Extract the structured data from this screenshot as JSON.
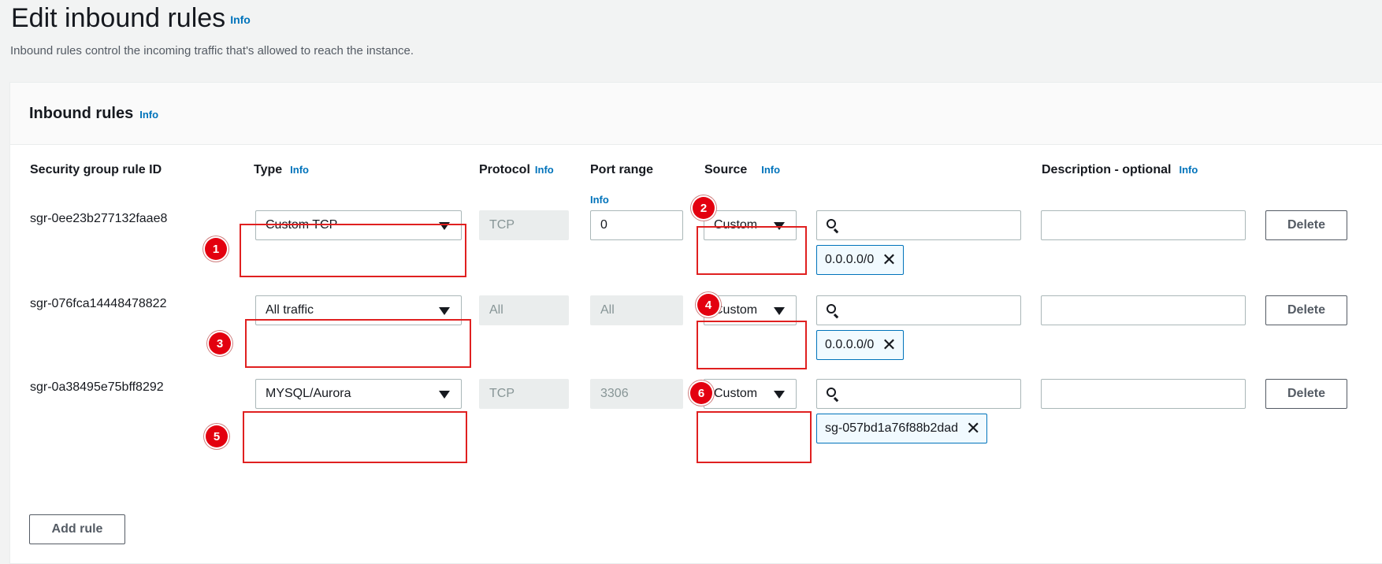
{
  "page": {
    "title": "Edit inbound rules",
    "info_label": "Info",
    "description": "Inbound rules control the incoming traffic that's allowed to reach the instance."
  },
  "panel": {
    "title": "Inbound rules",
    "info_label": "Info"
  },
  "columns": {
    "rule_id": "Security group rule ID",
    "type": "Type",
    "protocol": "Protocol",
    "port_range": "Port range",
    "source": "Source",
    "description": "Description - optional",
    "info_label": "Info"
  },
  "rules": [
    {
      "id": "sgr-0ee23b277132faae8",
      "type": "Custom TCP",
      "protocol": "TCP",
      "port_range": "0",
      "source_mode": "Custom",
      "source_search": "",
      "source_token": "0.0.0.0/0",
      "description": "",
      "delete_label": "Delete"
    },
    {
      "id": "sgr-076fca14448478822",
      "type": "All traffic",
      "protocol": "All",
      "port_range": "All",
      "source_mode": "Custom",
      "source_search": "",
      "source_token": "0.0.0.0/0",
      "description": "",
      "delete_label": "Delete"
    },
    {
      "id": "sgr-0a38495e75bff8292",
      "type": "MYSQL/Aurora",
      "protocol": "TCP",
      "port_range": "3306",
      "source_mode": "Custom",
      "source_search": "",
      "source_token": "sg-057bd1a76f88b2dad",
      "description": "",
      "delete_label": "Delete"
    }
  ],
  "add_rule_label": "Add rule",
  "annotations": [
    "1",
    "2",
    "3",
    "4",
    "5",
    "6"
  ],
  "colors": {
    "link": "#0073bb",
    "annotation_red": "#e3000f",
    "token_bg": "#f1faff"
  }
}
